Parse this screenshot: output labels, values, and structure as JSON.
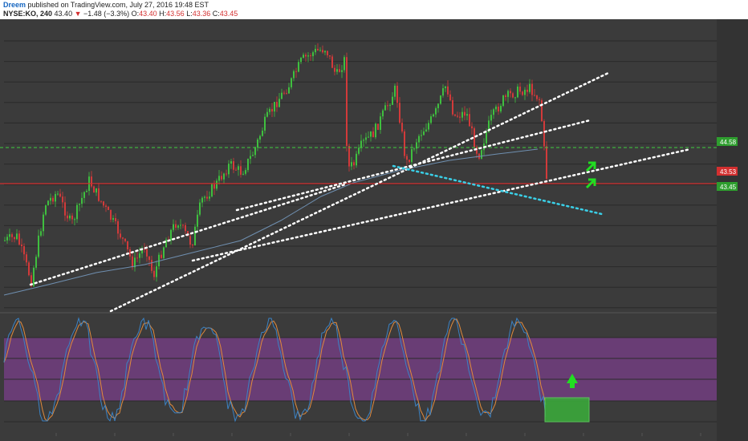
{
  "header": {
    "author": "Dreem",
    "published": "published on TradingView.com, July 27, 2016 19:48 EST",
    "symbol": "NYSE:KO, 240",
    "last": "43.40",
    "change_arrow": "▼",
    "change": "−1.48 (−3.3%)",
    "o_label": "O:",
    "o_val": "43.40",
    "h_label": "H:",
    "h_val": "43.56",
    "l_label": "L:",
    "l_val": "43.36",
    "c_label": "C:",
    "c_val": "43.45"
  },
  "price_labels": [
    {
      "text": "44.58",
      "color": "#2e9e2e"
    },
    {
      "text": "43.53",
      "color": "#d32f2f"
    },
    {
      "text": "43.45",
      "color": "#2e9e2e"
    }
  ],
  "colors": {
    "background": "#3b3b3b",
    "support_red": "#d32f2f",
    "resistance_green": "#3fcf3f",
    "trend_white": "#ffffff",
    "trend_cyan": "#3ad0e8",
    "osc_band": "#7a3f8a",
    "osc_k": "#3b82c4",
    "osc_d": "#e08a3c",
    "target_box": "#3aa83a"
  },
  "chart_data": {
    "type": "line",
    "annotations": [
      "green up arrows",
      "dotted trendlines",
      "green target box"
    ]
  }
}
